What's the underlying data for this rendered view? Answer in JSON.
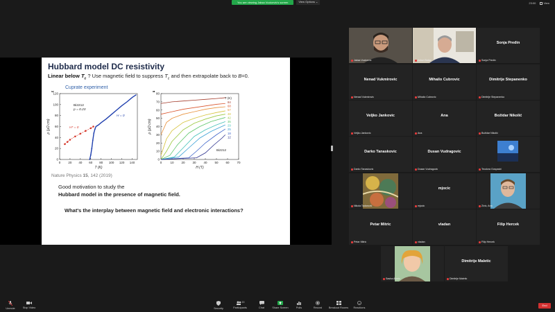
{
  "banner": {
    "sharing_text": "You are viewing Jaksa Vucicevic's screen",
    "view_options": "View Options ⌄"
  },
  "status": {
    "time": "23:00",
    "view_label": "View"
  },
  "slide": {
    "title": "Hubbard model DC resistivity",
    "subtitle_bold": "Linear below ",
    "subtitle_tc": "T",
    "subtitle_rest": " ? Use magnetic field to suppress ",
    "subtitle_rest2": " and then extrapolate back to ",
    "subtitle_b": "B",
    "subtitle_end": "=0.",
    "cuprate_label": "Cuprate experiment",
    "citation_prefix": "Nature Physics ",
    "citation_vol": "15",
    "citation_rest": ", 142 (2019)",
    "motivation_line1": "Good motivation to study the",
    "motivation_line2": "Hubbard model in the presence of magnetic field.",
    "interplay": "What's the interplay between magnetic field and electronic interactions?"
  },
  "chart_data": [
    {
      "type": "scatter",
      "panel_label": "b",
      "xlabel": "T (K)",
      "ylabel": "ρ (μΩ cm)",
      "xlim": [
        0,
        150
      ],
      "ylim": [
        0,
        120
      ],
      "x_ticks": [
        0,
        20,
        40,
        60,
        80,
        100,
        120,
        140
      ],
      "y_ticks": [
        0,
        20,
        40,
        60,
        80,
        100,
        120
      ],
      "annotations": [
        "Bi2212",
        "p = 0.23",
        "H = 0",
        "H* = 0"
      ],
      "series": [
        {
          "color": "#1f3fae",
          "x": [
            58,
            60,
            62,
            64,
            66,
            68,
            70,
            75,
            80,
            90,
            100,
            110,
            120,
            130,
            140,
            148
          ],
          "y": [
            0,
            8,
            20,
            35,
            48,
            55,
            60,
            63,
            67,
            74,
            82,
            90,
            98,
            105,
            113,
            118
          ]
        },
        {
          "color": "#d6372a",
          "x": [
            10,
            15,
            20,
            30,
            40,
            50,
            60,
            65
          ],
          "y": [
            28,
            32,
            36,
            42,
            47,
            52,
            57,
            60
          ]
        }
      ]
    },
    {
      "type": "line",
      "panel_label": "a",
      "xlabel": "H (T)",
      "ylabel": "ρ (μΩ cm)",
      "xlim": [
        0,
        70
      ],
      "ylim": [
        0,
        80
      ],
      "x_ticks": [
        0,
        10,
        20,
        30,
        40,
        50,
        60,
        70
      ],
      "y_ticks": [
        0,
        10,
        20,
        30,
        40,
        50,
        60,
        70,
        80
      ],
      "legend_title": "T (K)",
      "annotations": [
        "Bi2212"
      ],
      "series": [
        {
          "name": "84",
          "color": "#a33a2a",
          "x": [
            0,
            10,
            20,
            30,
            40,
            50,
            58
          ],
          "y": [
            68,
            70,
            71,
            72,
            73,
            74,
            75
          ]
        },
        {
          "name": "68",
          "color": "#d9542c",
          "x": [
            0,
            10,
            20,
            30,
            40,
            50,
            58
          ],
          "y": [
            55,
            58,
            61,
            63,
            65,
            67,
            68
          ]
        },
        {
          "name": "57",
          "color": "#e8903a",
          "x": [
            0,
            5,
            10,
            20,
            30,
            40,
            50,
            58
          ],
          "y": [
            30,
            45,
            50,
            55,
            58,
            61,
            63,
            64
          ]
        },
        {
          "name": "48",
          "color": "#d6c23a",
          "x": [
            0,
            5,
            10,
            20,
            30,
            40,
            50,
            58
          ],
          "y": [
            5,
            25,
            35,
            45,
            50,
            54,
            57,
            59
          ]
        },
        {
          "name": "42",
          "color": "#9bc83f",
          "x": [
            0,
            5,
            10,
            20,
            30,
            40,
            50,
            58
          ],
          "y": [
            0,
            10,
            22,
            36,
            44,
            49,
            53,
            55
          ]
        },
        {
          "name": "35",
          "color": "#5cc56a",
          "x": [
            0,
            8,
            15,
            25,
            35,
            45,
            58
          ],
          "y": [
            0,
            5,
            18,
            32,
            40,
            46,
            51
          ]
        },
        {
          "name": "29",
          "color": "#43c0b7",
          "x": [
            0,
            12,
            20,
            30,
            40,
            50,
            58
          ],
          "y": [
            0,
            3,
            14,
            28,
            36,
            42,
            46
          ]
        },
        {
          "name": "25",
          "color": "#3aa0d6",
          "x": [
            0,
            16,
            25,
            35,
            45,
            58
          ],
          "y": [
            0,
            3,
            14,
            26,
            34,
            42
          ]
        },
        {
          "name": "18",
          "color": "#3c63c9",
          "x": [
            0,
            25,
            32,
            40,
            50,
            58
          ],
          "y": [
            0,
            2,
            10,
            20,
            30,
            37
          ]
        },
        {
          "name": "12",
          "color": "#2a2f8c",
          "x": [
            0,
            32,
            40,
            48,
            55,
            58
          ],
          "y": [
            0,
            2,
            8,
            18,
            26,
            30
          ]
        }
      ]
    }
  ],
  "participants": [
    {
      "name": "Jaksa Vucicevic",
      "tile_label": "",
      "video": "face1",
      "active": true
    },
    {
      "name": "Antun Balaz",
      "tile_label": "",
      "video": "face2",
      "active": false
    },
    {
      "name": "Sonja Predin",
      "tile_label": "Sonja Predin",
      "video": "",
      "active": false
    },
    {
      "name": "Nenad Vukmirovic",
      "tile_label": "Nenad Vukmirovic",
      "video": "",
      "active": false
    },
    {
      "name": "Mihailo Cubrovic",
      "tile_label": "Mihailo Cubrovic",
      "video": "",
      "active": false
    },
    {
      "name": "Dimitrije Stepanenko",
      "tile_label": "Dimitrije Stepanenko",
      "video": "",
      "active": false
    },
    {
      "name": "Veljko Jankovic",
      "tile_label": "Veljko Jankovic",
      "video": "",
      "active": false
    },
    {
      "name": "Ana",
      "tile_label": "Ana",
      "video": "",
      "active": false
    },
    {
      "name": "Božidar Nikolić",
      "tile_label": "Božidar Nikolić",
      "video": "",
      "active": false
    },
    {
      "name": "Darko Tanaskovic",
      "tile_label": "Darko Tanaskovic",
      "video": "",
      "active": false
    },
    {
      "name": "Dusan Vudragovic",
      "tile_label": "Dusan Vudragovic",
      "video": "",
      "active": false
    },
    {
      "name": "Teodora Gospavić",
      "tile_label": "",
      "video": "photo-blue",
      "active": false
    },
    {
      "name": "Nikola Tadarović",
      "tile_label": "",
      "video": "painting",
      "active": false
    },
    {
      "name": "mjocic",
      "tile_label": "mjocic",
      "video": "",
      "active": false
    },
    {
      "name": "Zivic, Ana",
      "tile_label": "",
      "video": "face3",
      "active": false
    },
    {
      "name": "Petar Mitric",
      "tile_label": "Petar Mitric",
      "video": "",
      "active": false
    },
    {
      "name": "vladan",
      "tile_label": "vladan",
      "video": "",
      "active": false
    },
    {
      "name": "Filip Hercek",
      "tile_label": "Filip Hercek",
      "video": "",
      "active": false
    },
    {
      "name": "Sasha Alonic",
      "tile_label": "",
      "video": "face4",
      "active": false
    },
    {
      "name": "Dimitrije Maletic",
      "tile_label": "Dimitrije Maletic",
      "video": "",
      "active": false
    }
  ],
  "toolbar": {
    "unmute": "Unmute",
    "stop_video": "Stop Video",
    "security": "Security",
    "participants": "Participants",
    "participants_count": "20",
    "chat": "Chat",
    "share_screen": "Share Screen",
    "polls": "Polls",
    "record": "Record",
    "breakout": "Breakout Rooms",
    "reactions": "Reactions",
    "end": "End"
  },
  "colors": {
    "accent_green": "#23a74a",
    "end_red": "#d23131",
    "active_border": "#c6d63a"
  }
}
